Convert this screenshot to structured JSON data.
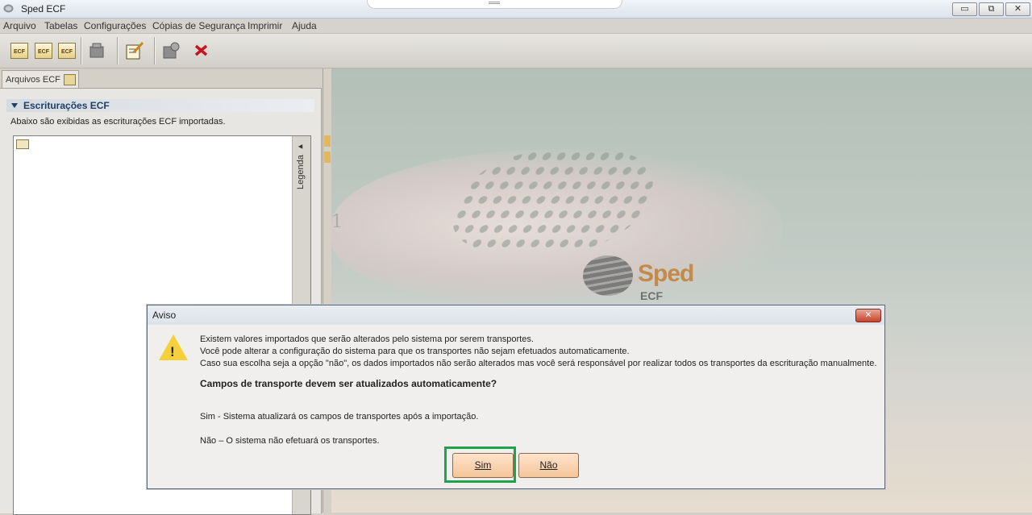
{
  "window": {
    "title": "Sped ECF"
  },
  "window_buttons": {
    "minimize": "▭",
    "maximize": "⧉",
    "close": "✕"
  },
  "menu": [
    "Arquivo",
    "Tabelas",
    "Configurações",
    "Cópias de Segurança",
    "Imprimir",
    "Ajuda"
  ],
  "toolbar": {
    "icon_text": "ECF",
    "icons": [
      "new-ecf-icon",
      "import-ecf-icon",
      "delete-ecf-icon",
      "package-icon",
      "edit-icon",
      "lock-icon",
      "cancel-x-icon"
    ]
  },
  "left_panel": {
    "tab_label": "Arquivos ECF",
    "section_title": "Escriturações ECF",
    "section_description": "Abaixo são exibidas as escriturações ECF importadas.",
    "legend_label": "Legenda ▸"
  },
  "splash": {
    "number": "1",
    "brand": "Sped",
    "sub": "ECF"
  },
  "dialog": {
    "title": "Aviso",
    "close": "✕",
    "warning_mark": "!",
    "lines": [
      "Existem valores importados que serão alterados pelo sistema por serem transportes.",
      "Você pode alterar a configuração do sistema para que os transportes não sejam efetuados automaticamente.",
      "Caso sua escolha seja a opção \"não\", os dados importados não serão alterados mas você será responsável por realizar todos os transportes da escrituração manualmente."
    ],
    "question": "Campos de transporte devem ser atualizados automaticamente?",
    "option_sim": "Sim - Sistema atualizará os campos de transportes após a importação.",
    "option_nao": "Não – O sistema não efetuará os transportes.",
    "btn_sim": "Sim",
    "btn_nao": "Não"
  },
  "colors": {
    "highlight": "#1ea24a",
    "button": "#f5c699",
    "accent": "#1e3f66"
  }
}
